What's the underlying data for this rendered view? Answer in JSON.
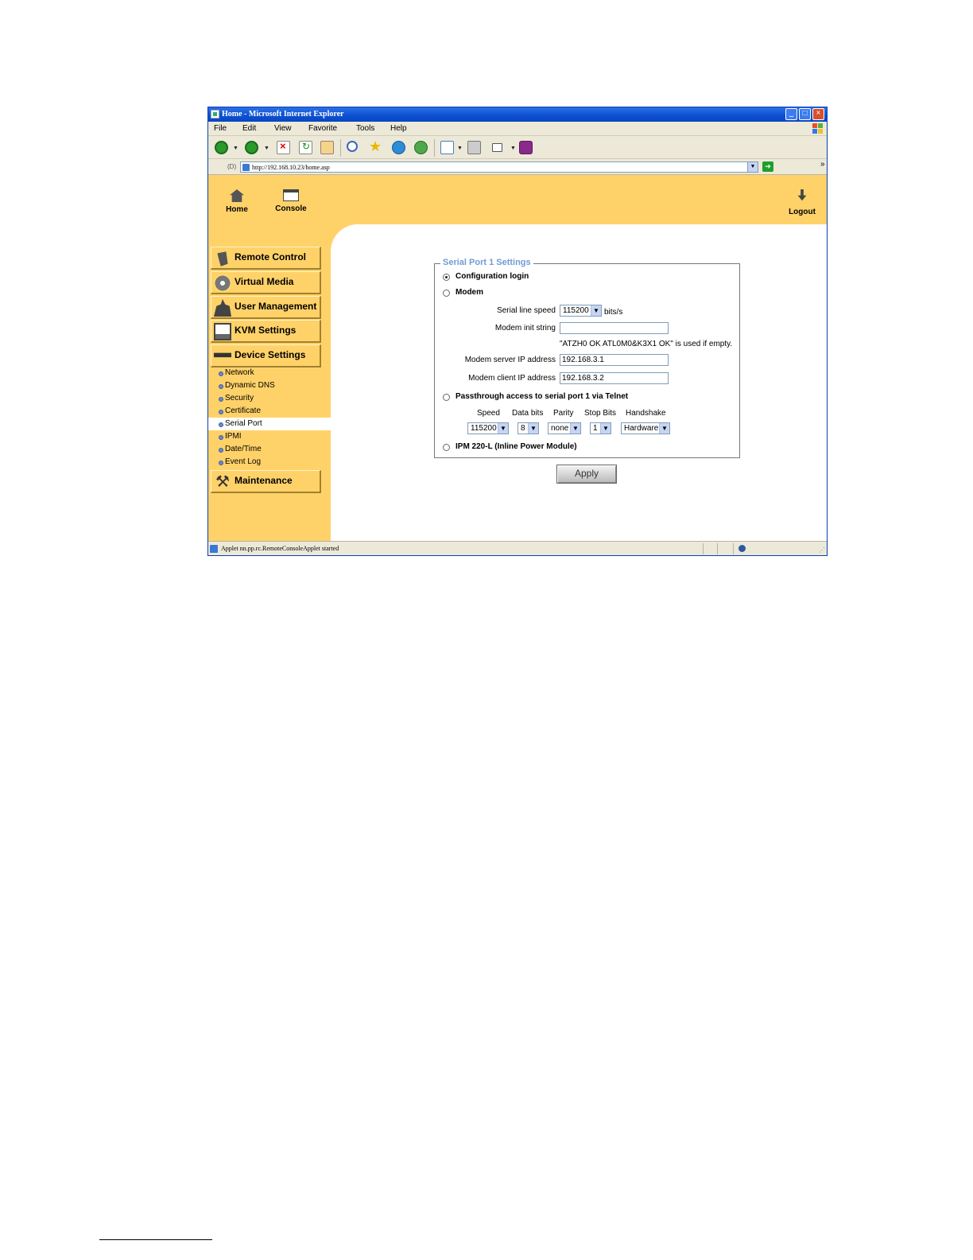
{
  "window": {
    "title": "Home - Microsoft Internet Explorer"
  },
  "menubar": {
    "items": [
      "File",
      "Edit",
      "View",
      "Favorite",
      "Tools",
      "Help"
    ]
  },
  "address": {
    "label": "(D)",
    "url": "http://192.168.10.23/home.asp"
  },
  "topnav": {
    "home": "Home",
    "console": "Console",
    "logout": "Logout"
  },
  "sidebar": {
    "menu": [
      {
        "label": "Remote Control",
        "icon": "remote-control-icon"
      },
      {
        "label": "Virtual Media",
        "icon": "virtual-media-icon"
      },
      {
        "label": "User Management",
        "icon": "user-management-icon"
      },
      {
        "label": "KVM Settings",
        "icon": "kvm-settings-icon"
      },
      {
        "label": "Device Settings",
        "icon": "device-settings-icon"
      }
    ],
    "submenu": [
      "Network",
      "Dynamic DNS",
      "Security",
      "Certificate",
      "Serial Port",
      "IPMI",
      "Date/Time",
      "Event Log"
    ],
    "active_submenu": "Serial Port",
    "maintenance": "Maintenance"
  },
  "form": {
    "legend": "Serial Port 1 Settings",
    "options": {
      "config_login": "Configuration login",
      "modem": "Modem",
      "passthrough": "Passthrough access to serial port 1 via Telnet",
      "ipm": "IPM 220-L (Inline Power Module)"
    },
    "selected_option": "Configuration login",
    "modem": {
      "serial_speed_label": "Serial line speed",
      "serial_speed_value": "115200",
      "serial_speed_unit": "bits/s",
      "init_string_label": "Modem init string",
      "init_string_value": "",
      "init_string_hint": "\"ATZH0 OK ATL0M0&K3X1 OK\" is used if empty.",
      "server_ip_label": "Modem server IP address",
      "server_ip_value": "192.168.3.1",
      "client_ip_label": "Modem client IP address",
      "client_ip_value": "192.168.3.2"
    },
    "passthrough": {
      "headers": [
        "Speed",
        "Data bits",
        "Parity",
        "Stop Bits",
        "Handshake"
      ],
      "values": [
        "115200",
        "8",
        "none",
        "1",
        "Hardware"
      ]
    },
    "apply_label": "Apply"
  },
  "status": {
    "text": "Applet nn.pp.rc.RemoteConsoleApplet started"
  }
}
